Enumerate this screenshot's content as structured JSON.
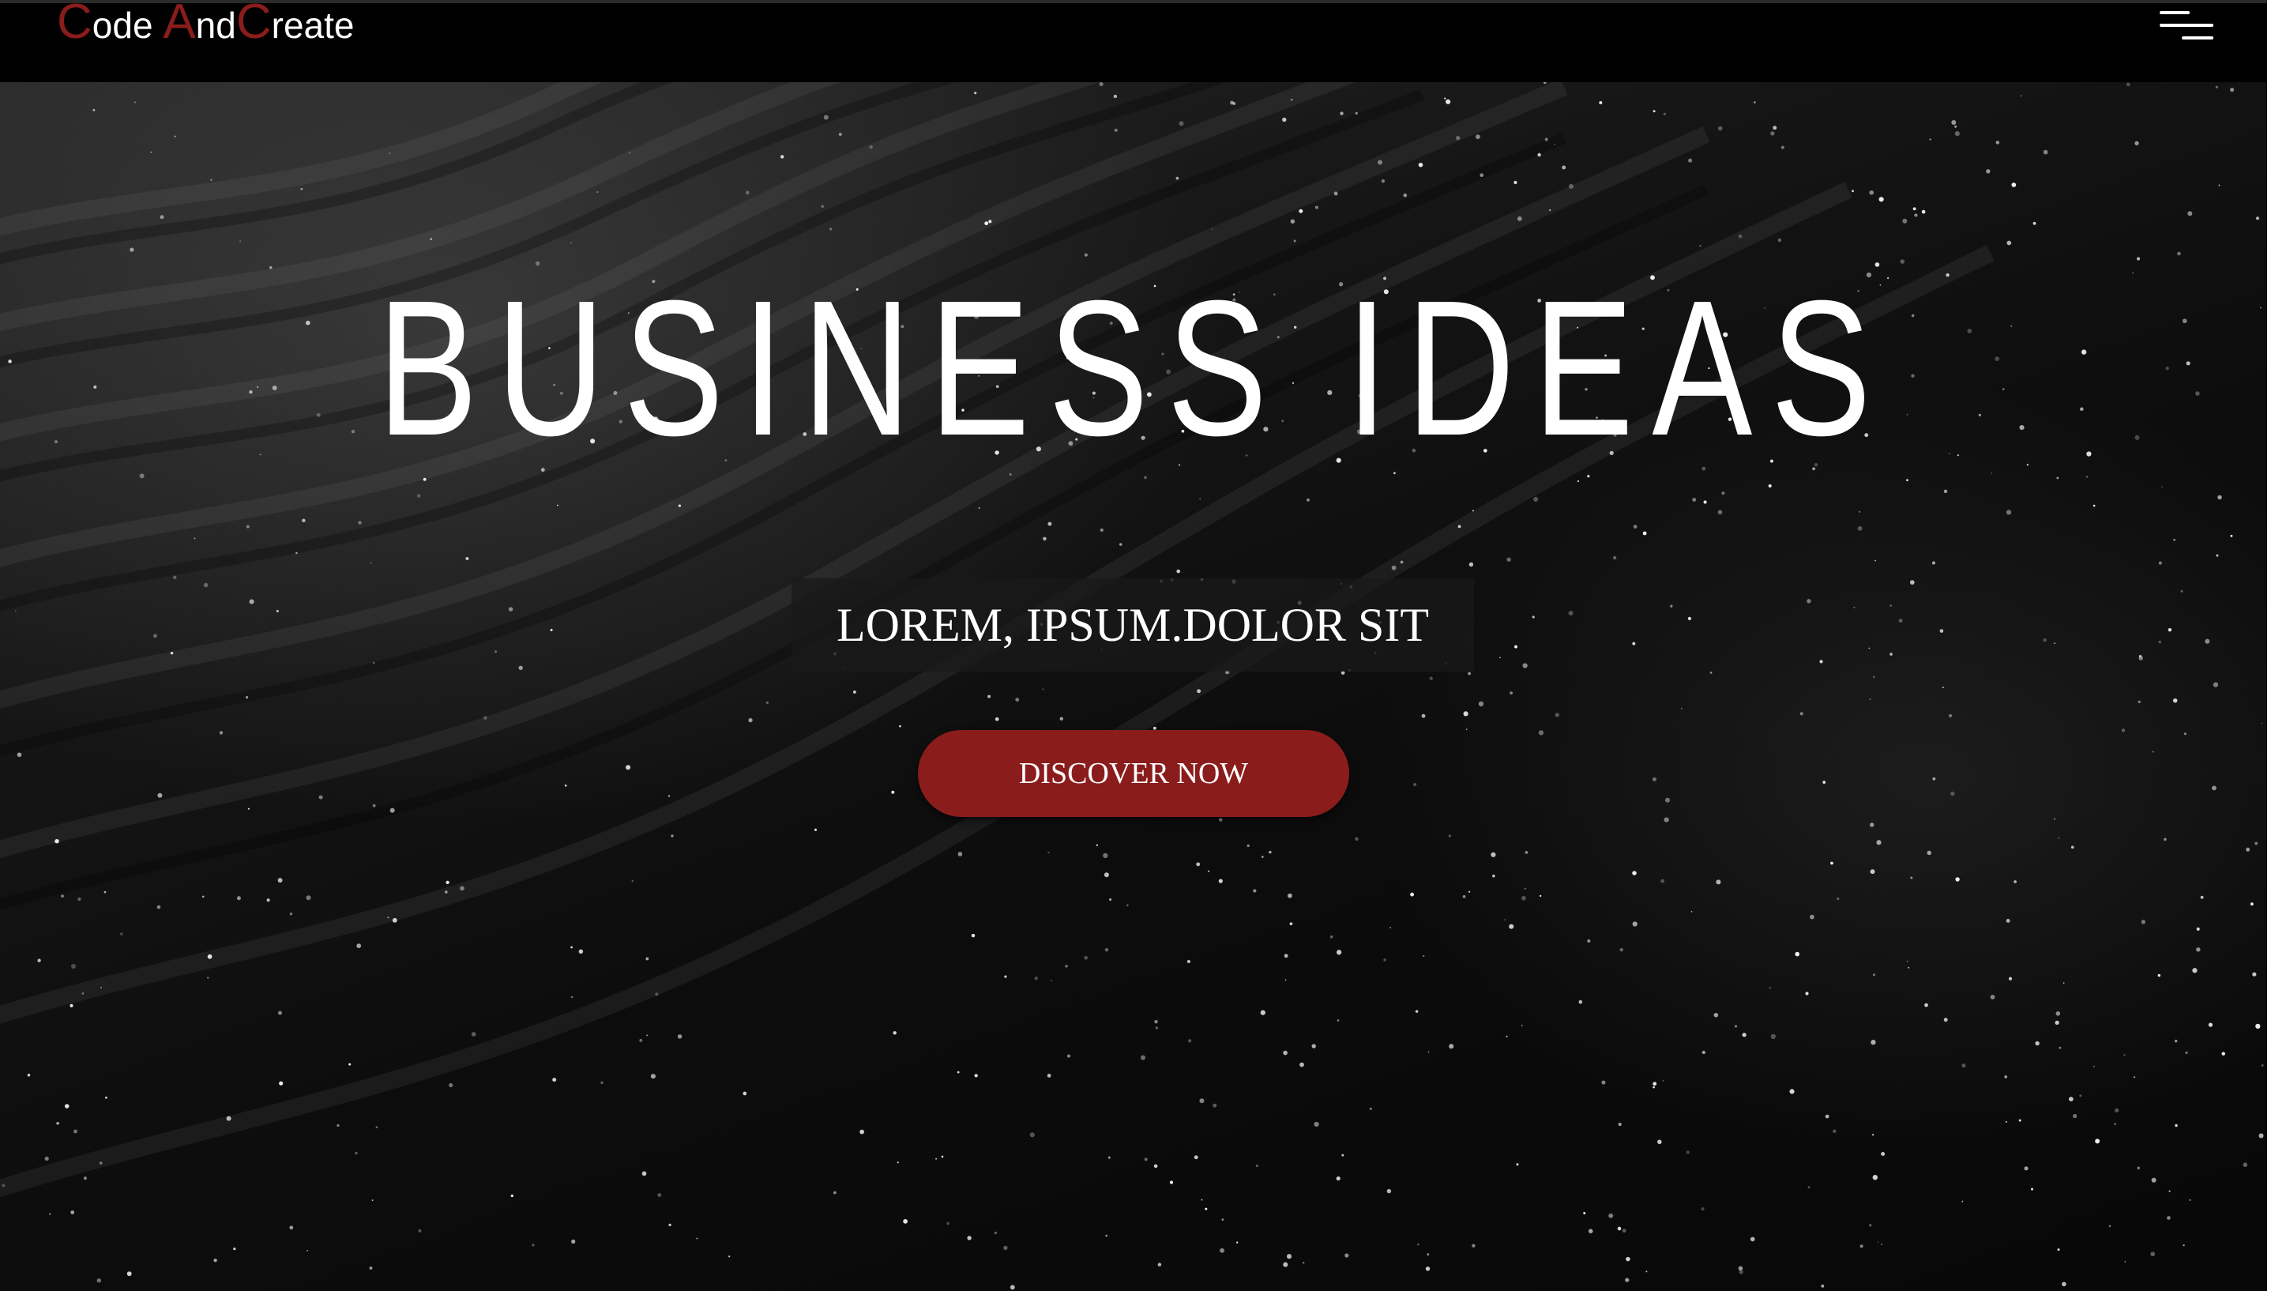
{
  "logo": {
    "parts": [
      {
        "cap": "C",
        "rest": "ode "
      },
      {
        "cap": "A",
        "rest": "nd"
      },
      {
        "cap": "C",
        "rest": "reate"
      }
    ]
  },
  "nav": {
    "menu_icon": "hamburger-menu-icon"
  },
  "hero": {
    "title": "BUSINESS IDEAS",
    "subtitle": "LOREM, IPSUM.DOLOR SIT",
    "cta_label": "DISCOVER NOW",
    "background": "dark sand dunes with sparkling grains"
  },
  "colors": {
    "accent": "#8b1c1c",
    "navbar": "#000000",
    "text": "#ffffff"
  }
}
